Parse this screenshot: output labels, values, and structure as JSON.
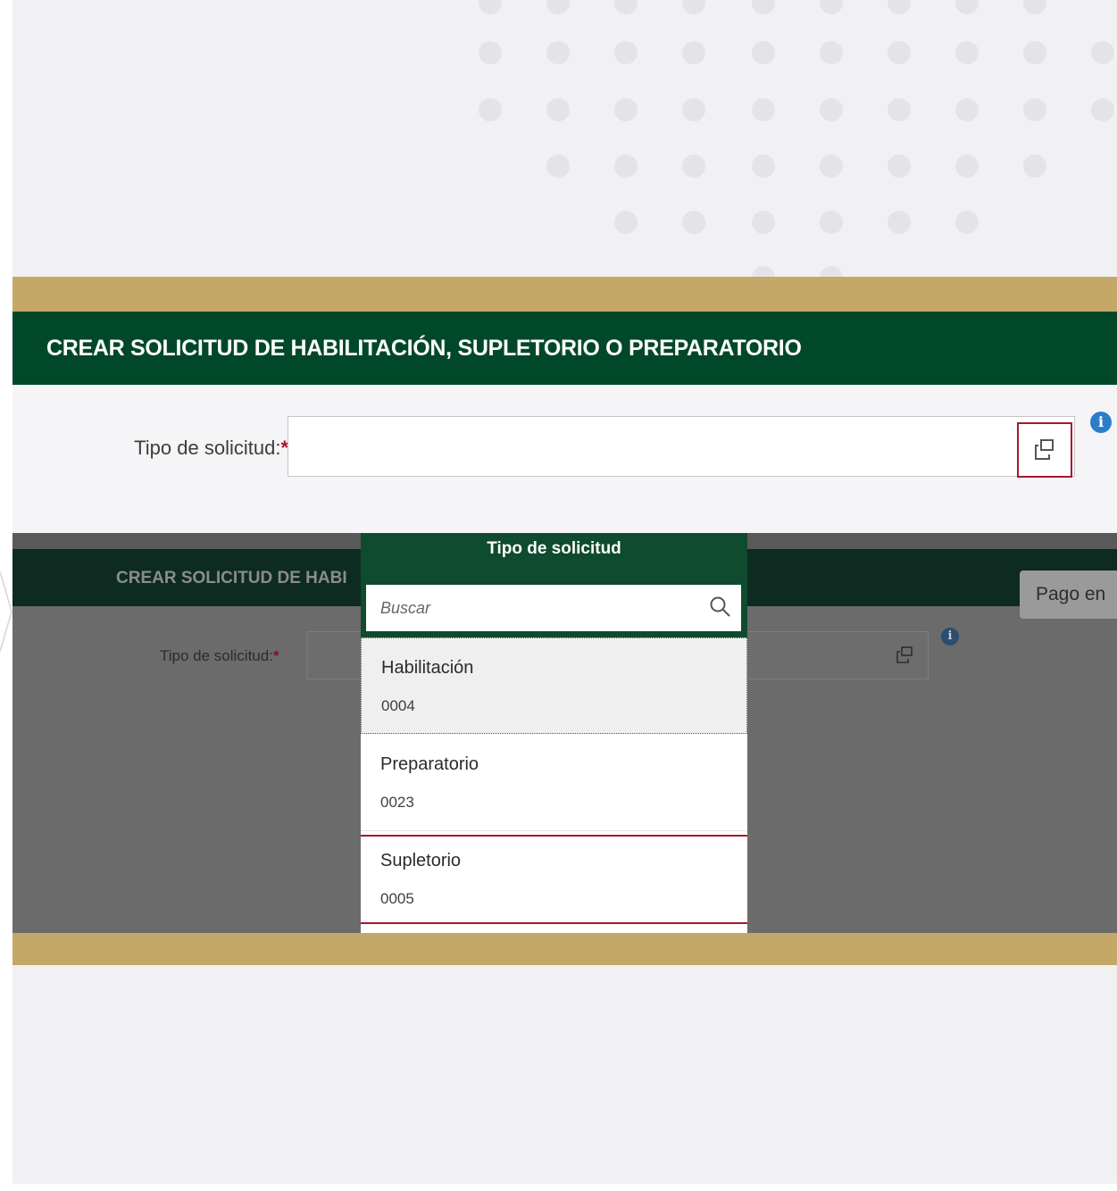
{
  "main": {
    "title": "CREAR SOLICITUD DE HABILITACIÓN, SUPLETORIO O PREPARATORIO",
    "field_label": "Tipo de solicitud:",
    "required_mark": "*"
  },
  "screenshot": {
    "title": "CREAR SOLICITUD DE HABI",
    "button_label": "Pago en",
    "field_label": "Tipo de solicitud:",
    "required_mark": "*"
  },
  "popup": {
    "title": "Tipo de solicitud",
    "search_placeholder": "Buscar",
    "items": [
      {
        "name": "Habilitación",
        "code": "0004"
      },
      {
        "name": "Preparatorio",
        "code": "0023"
      },
      {
        "name": "Supletorio",
        "code": "0005"
      }
    ]
  },
  "icons": {
    "value_help": "value-help-icon",
    "info": "info-icon",
    "search": "search-icon"
  },
  "colors": {
    "header_green": "#01482b",
    "gold": "#c4a868",
    "highlight_red": "#a6182b",
    "info_blue": "#2a7ec9"
  }
}
